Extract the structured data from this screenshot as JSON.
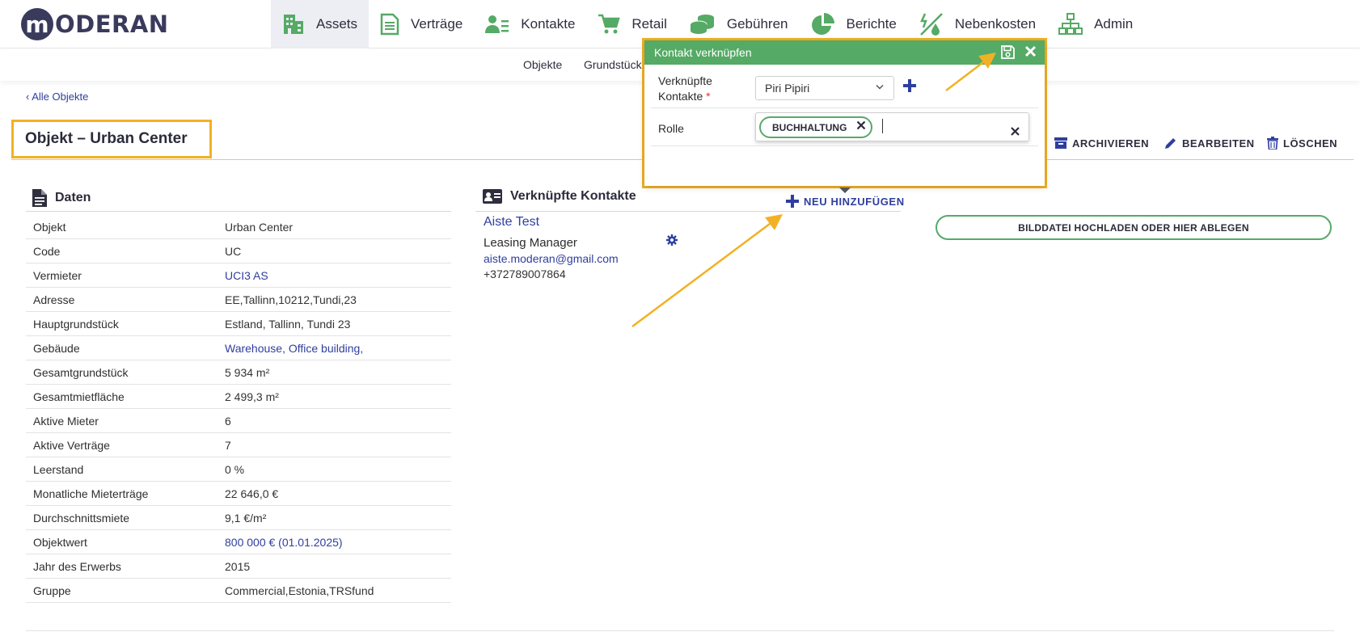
{
  "brand": {
    "logo_letter": "m",
    "logo_text": "ODERAN"
  },
  "nav": {
    "items": [
      {
        "label": "Assets"
      },
      {
        "label": "Verträge"
      },
      {
        "label": "Kontakte"
      },
      {
        "label": "Retail"
      },
      {
        "label": "Gebühren"
      },
      {
        "label": "Berichte"
      },
      {
        "label": "Nebenkosten"
      },
      {
        "label": "Admin"
      }
    ]
  },
  "subnav": {
    "items": [
      {
        "label": "Objekte"
      },
      {
        "label": "Grundstück"
      }
    ]
  },
  "back_link": "‹ Alle Objekte",
  "page_title": "Objekt – Urban Center",
  "actions": {
    "archive": "ARCHIVIEREN",
    "edit": "BEARBEITEN",
    "delete": "LÖSCHEN"
  },
  "data_section": {
    "title": "Daten",
    "rows": [
      {
        "key": "Objekt",
        "value": "Urban Center"
      },
      {
        "key": "Code",
        "value": "UC"
      },
      {
        "key": "Vermieter",
        "value": "UCI3 AS"
      },
      {
        "key": "Adresse",
        "value": "EE,Tallinn,10212,Tundi,23"
      },
      {
        "key": "Hauptgrundstück",
        "value": "Estland, Tallinn, Tundi 23"
      },
      {
        "key": "Gebäude",
        "value": "Warehouse, Office building,"
      },
      {
        "key": "Gesamtgrundstück",
        "value": "5 934 m²"
      },
      {
        "key": "Gesamtmietfläche",
        "value": "2 499,3 m²"
      },
      {
        "key": "Aktive Mieter",
        "value": "6"
      },
      {
        "key": "Aktive Verträge",
        "value": "7"
      },
      {
        "key": "Leerstand",
        "value": "0 %"
      },
      {
        "key": "Monatliche Mieterträge",
        "value": "22 646,0 €"
      },
      {
        "key": "Durchschnittsmiete",
        "value": "9,1 €/m²"
      },
      {
        "key": "Objektwert",
        "value": "800 000 € (01.01.2025)"
      },
      {
        "key": "Jahr des Erwerbs",
        "value": "2015"
      },
      {
        "key": "Gruppe",
        "value": "Commercial,Estonia,TRSfund"
      }
    ]
  },
  "contacts_section": {
    "title": "Verknüpfte Kontakte",
    "add_label": "NEU HINZUFÜGEN",
    "contact": {
      "name": "Aiste Test",
      "role": "Leasing Manager",
      "email": "aiste.moderan@gmail.com",
      "phone": "+372789007864"
    }
  },
  "upload_label": "BILDDATEI HOCHLADEN ODER HIER ABLEGEN",
  "modal": {
    "title": "Kontakt verknüpfen",
    "linked_label_1": "Verknüpfte",
    "linked_label_2": "Kontakte",
    "required_mark": "*",
    "selected_contact": "Piri Pipiri",
    "role_label": "Rolle",
    "role_tag": "BUCHHALTUNG"
  },
  "colors": {
    "accent_green": "#55aa65",
    "link_blue": "#2f3e9e",
    "highlight": "#f2b124"
  }
}
